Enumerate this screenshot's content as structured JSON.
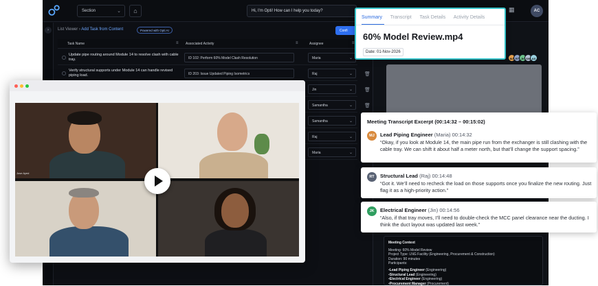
{
  "topbar": {
    "section_label": "Section",
    "assistant_placeholder": "Hi, I'm Opti! How can I help you today?",
    "user_initials": "AC"
  },
  "breadcrumb": {
    "root": "List Viewer",
    "current": "Add Task from Content",
    "badge": "Powered with Opti AI"
  },
  "confirm_label": "Confi",
  "table": {
    "headers": {
      "task": "Task Name",
      "activity": "Associated Activity",
      "assignee": "Assignee"
    },
    "rows": [
      {
        "task": "Update pipe routing around Module 14 to resolve clash with cable tray.",
        "activity": "ID 102: Perform 60% Model Clash Resolution",
        "assignee": "Maria"
      },
      {
        "task": "Verify structural supports under Module 14 can handle revised piping load.",
        "activity": "ID 203: Issue Updated Piping Isometrics",
        "assignee": "Raj"
      },
      {
        "task": "",
        "activity": "",
        "assignee": "Jin"
      },
      {
        "task": "",
        "activity": "",
        "assignee": "Samantha"
      },
      {
        "task": "",
        "activity": "",
        "assignee": "Samantha"
      },
      {
        "task": "",
        "activity": "",
        "assignee": "Raj"
      },
      {
        "task": "",
        "activity": "",
        "assignee": "Maria"
      }
    ]
  },
  "summary": {
    "tabs": [
      "Summary",
      "Transcript",
      "Task Details",
      "Activity Details"
    ],
    "title": "60% Model Review.mp4",
    "date": "Date: 01-Nov-2026"
  },
  "participants_avatars": [
    "MJ",
    "RT",
    "JK",
    "SW",
    "AS"
  ],
  "video": {
    "name_tag": "Jose Ayed"
  },
  "transcript": {
    "heading": "Meeting Transcript Excerpt (00:14:32 – 00:15:02)",
    "entries": [
      {
        "initials": "MJ",
        "color": "#d98a3d",
        "role": "Lead Piping Engineer",
        "person": "(Maria)",
        "time": "00:14:32",
        "quote": "“Okay, if you look at Module 14, the main pipe run from the exchanger is still clashing with the cable tray. We can shift it about half a meter north, but that’ll change the support spacing.”"
      },
      {
        "initials": "RT",
        "color": "#596274",
        "role": "Structural Lead",
        "person": "(Raj)",
        "time": "00:14:48",
        "quote": "“Got it. We’ll need to recheck the load on those supports once you finalize the new routing. Just flag it as a high-priority action.”"
      },
      {
        "initials": "JK",
        "color": "#2f9e5f",
        "role": "Electrical Engineer",
        "person": "(Jin)",
        "time": "00:14:56",
        "quote": "“Also, if that tray moves, I’ll need to double-check the MCC panel clearance near the ducting. I think the duct layout was updated last week.”"
      }
    ]
  },
  "context": {
    "heading": "Meeting Context",
    "lines": [
      "Meeting: 60% Model Review",
      "Project Type: LNG Facility (Engineering, Procurement & Construction)",
      "Duration: 90 minutes",
      "Participants:"
    ],
    "participants": [
      {
        "role": "Lead Piping Engineer",
        "dept": "(Engineering)"
      },
      {
        "role": "Structural Lead",
        "dept": "(Engineering)"
      },
      {
        "role": "Electrical Engineer",
        "dept": "(Engineering)"
      },
      {
        "role": "Procurement Manager",
        "dept": "(Procurement)"
      }
    ]
  },
  "colors": {
    "accent": "#2c6ce0",
    "summary_border": "#36c3c9",
    "app_bg": "#0d0f14"
  }
}
